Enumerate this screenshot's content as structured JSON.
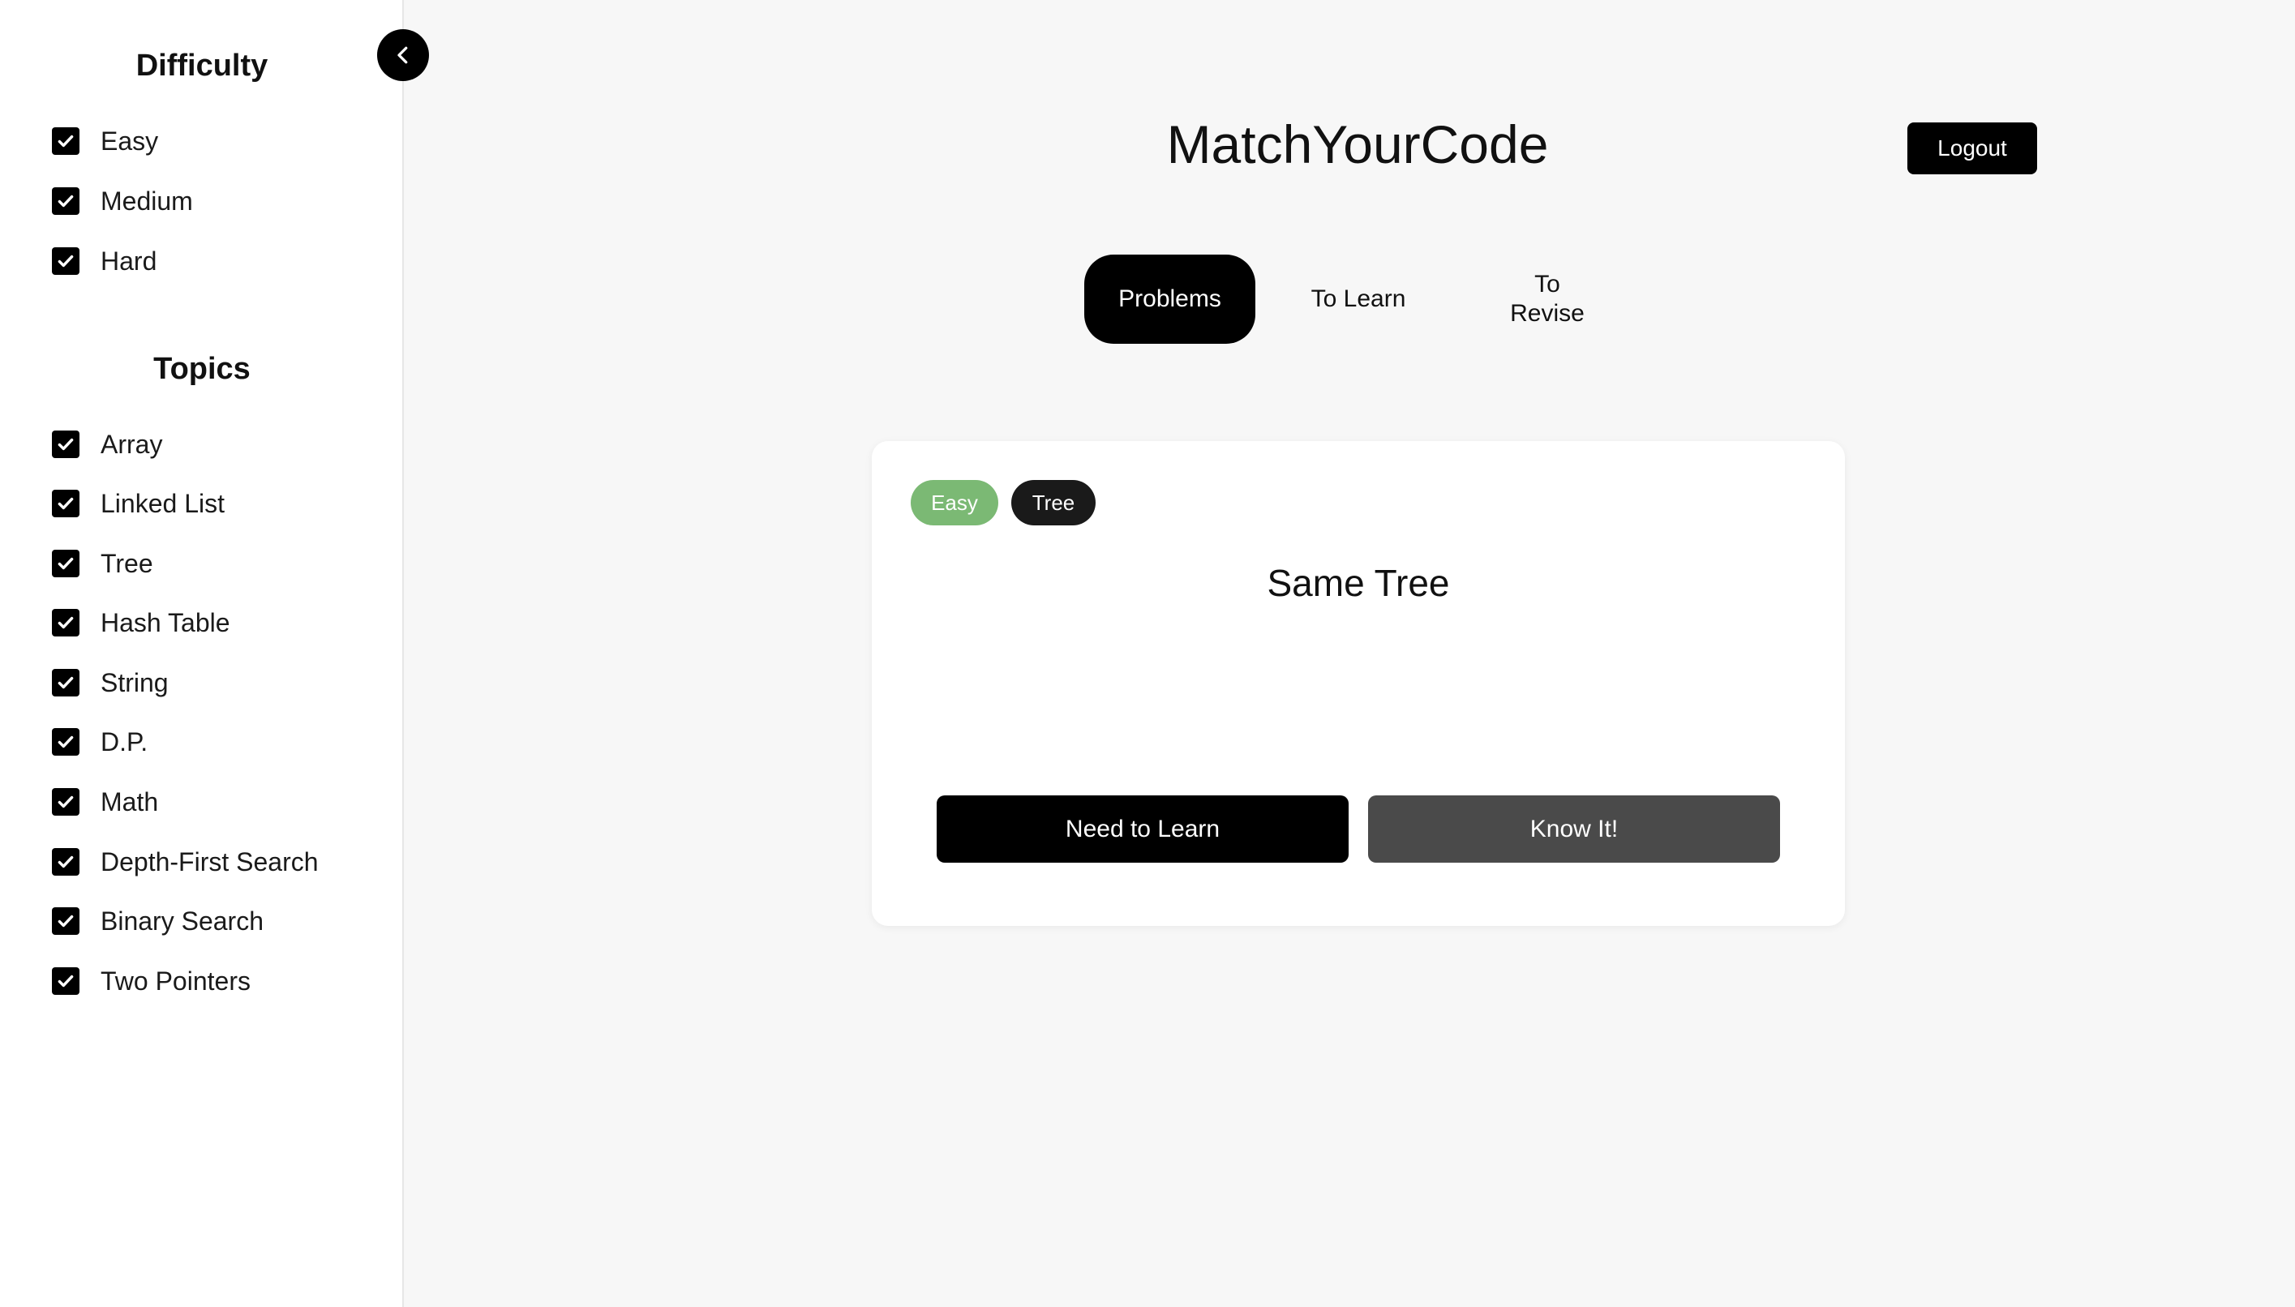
{
  "app": {
    "title": "MatchYourCode",
    "logout_label": "Logout"
  },
  "sidebar": {
    "difficulty_title": "Difficulty",
    "difficulty": [
      {
        "label": "Easy",
        "checked": true
      },
      {
        "label": "Medium",
        "checked": true
      },
      {
        "label": "Hard",
        "checked": true
      }
    ],
    "topics_title": "Topics",
    "topics": [
      {
        "label": "Array",
        "checked": true
      },
      {
        "label": "Linked List",
        "checked": true
      },
      {
        "label": "Tree",
        "checked": true
      },
      {
        "label": "Hash Table",
        "checked": true
      },
      {
        "label": "String",
        "checked": true
      },
      {
        "label": "D.P.",
        "checked": true
      },
      {
        "label": "Math",
        "checked": true
      },
      {
        "label": "Depth-First Search",
        "checked": true
      },
      {
        "label": "Binary Search",
        "checked": true
      },
      {
        "label": "Two Pointers",
        "checked": true
      }
    ],
    "collapse_icon": "chevron-left-icon"
  },
  "tabs": [
    {
      "label": "Problems",
      "active": true
    },
    {
      "label": "To Learn",
      "active": false
    },
    {
      "label": "To\nRevise",
      "active": false
    }
  ],
  "card": {
    "difficulty_badge": "Easy",
    "topic_badge": "Tree",
    "title": "Same Tree",
    "need_to_learn_label": "Need to Learn",
    "know_it_label": "Know It!"
  },
  "colors": {
    "easy_badge": "#7bb974",
    "topic_badge": "#1a1a1a",
    "primary_button": "#000000",
    "secondary_button": "#4a4a4a",
    "background": "#f7f7f7"
  }
}
